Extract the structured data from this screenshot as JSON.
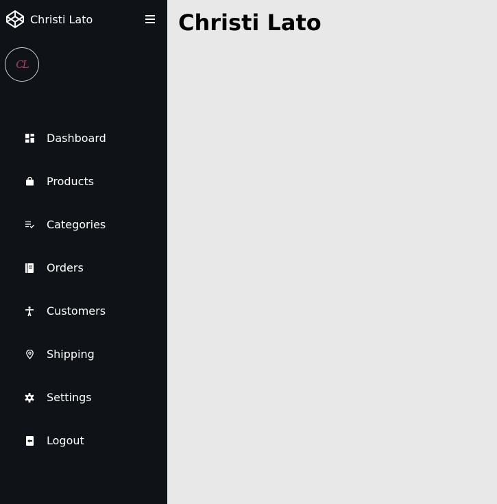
{
  "brand": {
    "name": "Christi Lato",
    "icon": "codepen-icon"
  },
  "avatar": {
    "text": "CL"
  },
  "sidebar": {
    "items": [
      {
        "label": "Dashboard",
        "icon": "dashboard-icon"
      },
      {
        "label": "Products",
        "icon": "shopping-bag-icon"
      },
      {
        "label": "Categories",
        "icon": "checklist-icon"
      },
      {
        "label": "Orders",
        "icon": "book-icon"
      },
      {
        "label": "Customers",
        "icon": "accessibility-icon"
      },
      {
        "label": "Shipping",
        "icon": "location-pin-icon"
      },
      {
        "label": "Settings",
        "icon": "gear-icon"
      },
      {
        "label": "Logout",
        "icon": "logout-icon"
      }
    ]
  },
  "main": {
    "title": "Christi Lato"
  },
  "colors": {
    "sidebar_bg": "#0f1217",
    "main_bg": "#e8e8e8",
    "text": "#ffffff",
    "avatar_accent": "#b0415c"
  }
}
